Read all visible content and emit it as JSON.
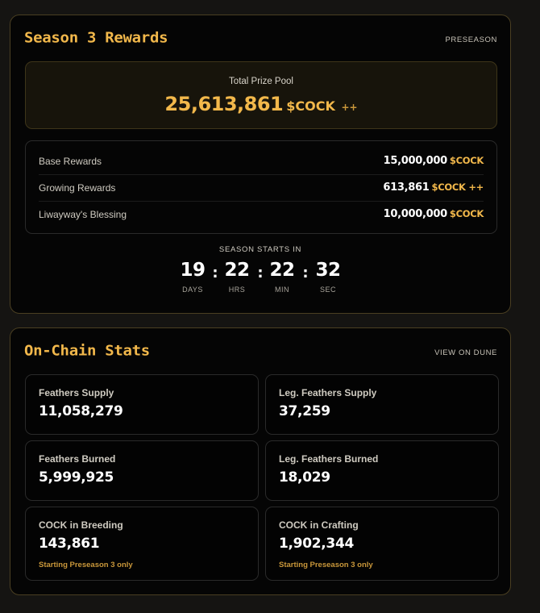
{
  "rewards_card": {
    "title": "Season 3 Rewards",
    "badge": "PRESEASON",
    "prize_pool": {
      "label": "Total Prize Pool",
      "amount": "25,613,861",
      "token": "$COCK",
      "suffix": "++"
    },
    "rewards": [
      {
        "label": "Base Rewards",
        "amount": "15,000,000",
        "token": "$COCK"
      },
      {
        "label": "Growing Rewards",
        "amount": "613,861",
        "token": "$COCK ++"
      },
      {
        "label": "Liwayway's Blessing",
        "amount": "10,000,000",
        "token": "$COCK"
      }
    ],
    "countdown": {
      "label": "SEASON STARTS IN",
      "separator": ":",
      "units": [
        {
          "value": "19",
          "caption": "DAYS"
        },
        {
          "value": "22",
          "caption": "HRS"
        },
        {
          "value": "22",
          "caption": "MIN"
        },
        {
          "value": "32",
          "caption": "SEC"
        }
      ]
    }
  },
  "stats_card": {
    "title": "On-Chain Stats",
    "link": "VIEW ON DUNE",
    "stats": [
      {
        "label": "Feathers Supply",
        "value": "11,058,279",
        "note": ""
      },
      {
        "label": "Leg. Feathers Supply",
        "value": "37,259",
        "note": ""
      },
      {
        "label": "Feathers Burned",
        "value": "5,999,925",
        "note": ""
      },
      {
        "label": "Leg. Feathers Burned",
        "value": "18,029",
        "note": ""
      },
      {
        "label": "COCK in Breeding",
        "value": "143,861",
        "note": "Starting Preseason 3 only"
      },
      {
        "label": "COCK in Crafting",
        "value": "1,902,344",
        "note": "Starting Preseason 3 only"
      }
    ]
  },
  "colors": {
    "accent": "#f2b84b",
    "accent_dim": "#c9973a",
    "card_border": "#4a3f22",
    "background": "#151412"
  }
}
